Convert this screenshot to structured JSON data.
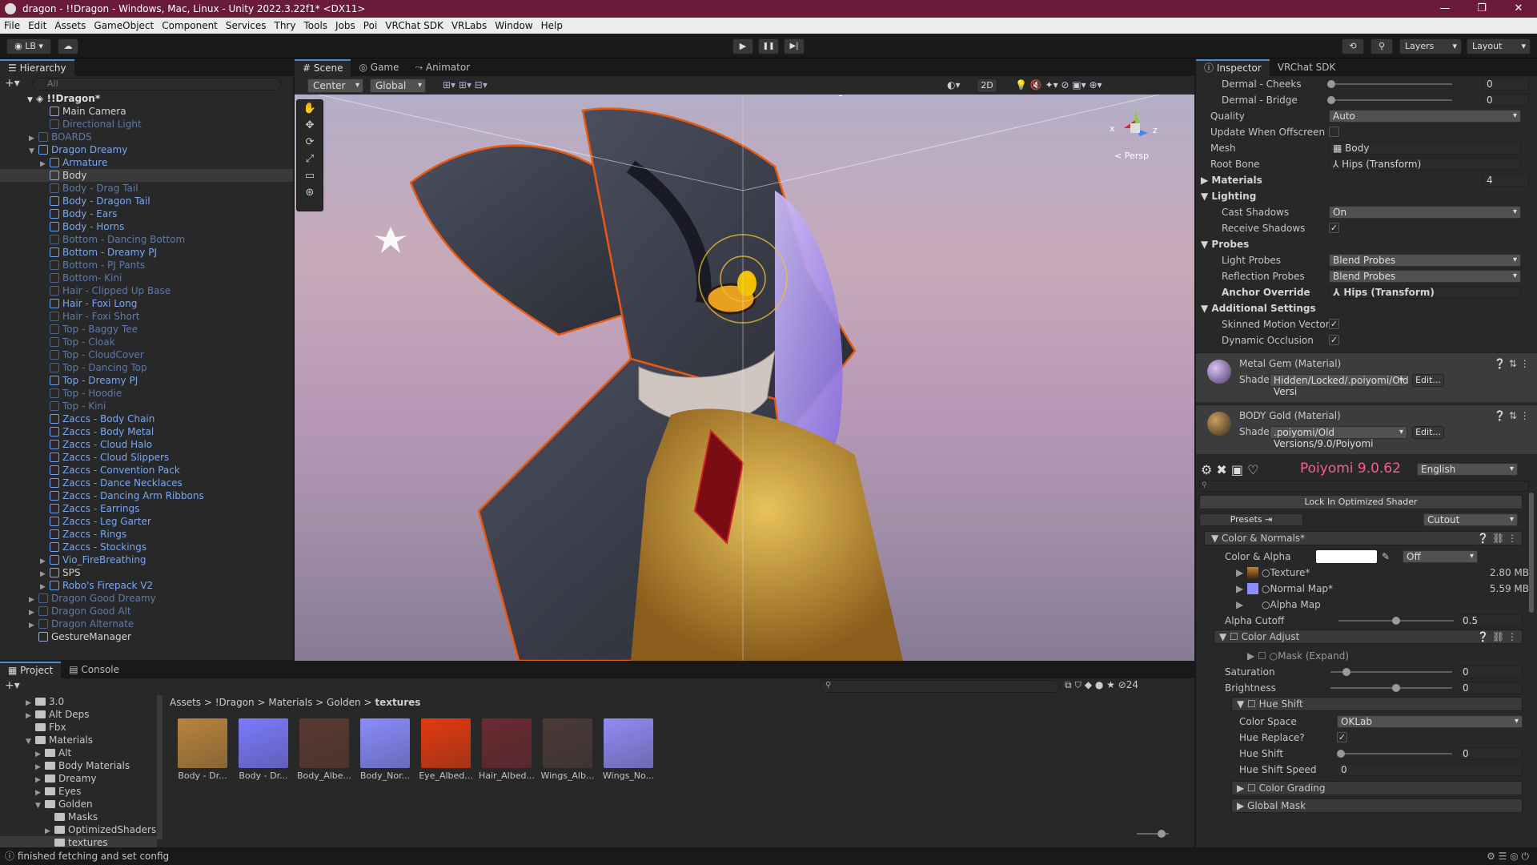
{
  "window": {
    "title": "dragon - !!Dragon - Windows, Mac, Linux - Unity 2022.3.22f1* <DX11>",
    "controls": [
      "—",
      "❐",
      "✕"
    ]
  },
  "menu": [
    "File",
    "Edit",
    "Assets",
    "GameObject",
    "Component",
    "Services",
    "Thry",
    "Tools",
    "Jobs",
    "Poi",
    "VRChat SDK",
    "VRLabs",
    "Window",
    "Help"
  ],
  "toolbar": {
    "account": "LB",
    "play": "▶",
    "pause": "❚❚",
    "step": "▶|",
    "layers": "Layers",
    "layout": "Layout"
  },
  "hierarchy": {
    "tab": "Hierarchy",
    "search_placeholder": "All",
    "root": "!!Dragon*",
    "rows": [
      {
        "label": "Main Camera",
        "style": "white",
        "indent": 1,
        "arrow": ""
      },
      {
        "label": "Directional Light",
        "style": "dim",
        "indent": 1,
        "arrow": ""
      },
      {
        "label": "BOARDS",
        "style": "dim",
        "indent": 0,
        "arrow": "▶"
      },
      {
        "label": "Dragon Dreamy",
        "style": "blue",
        "indent": 0,
        "arrow": "▼"
      },
      {
        "label": "Armature",
        "style": "blue",
        "indent": 1,
        "arrow": "▶"
      },
      {
        "label": "Body",
        "style": "white",
        "indent": 1,
        "arrow": "",
        "selected": true
      },
      {
        "label": "Body - Drag Tail",
        "style": "dim",
        "indent": 1,
        "arrow": ""
      },
      {
        "label": "Body - Dragon Tail",
        "style": "blue",
        "indent": 1,
        "arrow": ""
      },
      {
        "label": "Body - Ears",
        "style": "blue",
        "indent": 1,
        "arrow": ""
      },
      {
        "label": "Body - Horns",
        "style": "blue",
        "indent": 1,
        "arrow": ""
      },
      {
        "label": "Bottom - Dancing Bottom",
        "style": "dim",
        "indent": 1,
        "arrow": ""
      },
      {
        "label": "Bottom - Dreamy PJ",
        "style": "blue",
        "indent": 1,
        "arrow": ""
      },
      {
        "label": "Bottom - PJ Pants",
        "style": "dim",
        "indent": 1,
        "arrow": ""
      },
      {
        "label": "Bottom- Kini",
        "style": "dim",
        "indent": 1,
        "arrow": ""
      },
      {
        "label": "Hair - Clipped Up Base",
        "style": "dim",
        "indent": 1,
        "arrow": ""
      },
      {
        "label": "Hair - Foxi Long",
        "style": "blue",
        "indent": 1,
        "arrow": ""
      },
      {
        "label": "Hair - Foxi Short",
        "style": "dim",
        "indent": 1,
        "arrow": ""
      },
      {
        "label": "Top - Baggy Tee",
        "style": "dim",
        "indent": 1,
        "arrow": ""
      },
      {
        "label": "Top - Cloak",
        "style": "dim",
        "indent": 1,
        "arrow": ""
      },
      {
        "label": "Top - CloudCover",
        "style": "dim",
        "indent": 1,
        "arrow": ""
      },
      {
        "label": "Top - Dancing Top",
        "style": "dim",
        "indent": 1,
        "arrow": ""
      },
      {
        "label": "Top - Dreamy PJ",
        "style": "blue",
        "indent": 1,
        "arrow": ""
      },
      {
        "label": "Top - Hoodie",
        "style": "dim",
        "indent": 1,
        "arrow": ""
      },
      {
        "label": "Top - Kini",
        "style": "dim",
        "indent": 1,
        "arrow": ""
      },
      {
        "label": "Zaccs - Body Chain",
        "style": "blue",
        "indent": 1,
        "arrow": ""
      },
      {
        "label": "Zaccs - Body Metal",
        "style": "blue",
        "indent": 1,
        "arrow": ""
      },
      {
        "label": "Zaccs - Cloud Halo",
        "style": "blue",
        "indent": 1,
        "arrow": ""
      },
      {
        "label": "Zaccs - Cloud Slippers",
        "style": "blue",
        "indent": 1,
        "arrow": ""
      },
      {
        "label": "Zaccs - Convention Pack",
        "style": "blue",
        "indent": 1,
        "arrow": ""
      },
      {
        "label": "Zaccs - Dance Necklaces",
        "style": "blue",
        "indent": 1,
        "arrow": ""
      },
      {
        "label": "Zaccs - Dancing Arm Ribbons",
        "style": "blue",
        "indent": 1,
        "arrow": ""
      },
      {
        "label": "Zaccs - Earrings",
        "style": "blue",
        "indent": 1,
        "arrow": ""
      },
      {
        "label": "Zaccs - Leg Garter",
        "style": "blue",
        "indent": 1,
        "arrow": ""
      },
      {
        "label": "Zaccs - Rings",
        "style": "blue",
        "indent": 1,
        "arrow": ""
      },
      {
        "label": "Zaccs - Stockings",
        "style": "blue",
        "indent": 1,
        "arrow": ""
      },
      {
        "label": "Vio_FireBreathing",
        "style": "blue",
        "indent": 1,
        "arrow": "▶"
      },
      {
        "label": "SPS",
        "style": "white",
        "indent": 1,
        "arrow": "▶"
      },
      {
        "label": "Robo's Firepack V2",
        "style": "blue",
        "indent": 1,
        "arrow": "▶"
      },
      {
        "label": "Dragon Good Dreamy",
        "style": "dim",
        "indent": 0,
        "arrow": "▶"
      },
      {
        "label": "Dragon Good Alt",
        "style": "dim",
        "indent": 0,
        "arrow": "▶"
      },
      {
        "label": "Dragon Alternate",
        "style": "dim",
        "indent": 0,
        "arrow": "▶"
      },
      {
        "label": "GestureManager",
        "style": "white",
        "indent": 0,
        "arrow": ""
      }
    ]
  },
  "scene": {
    "tabs": [
      "Scene",
      "Game",
      "Animator"
    ],
    "pivot": "Center",
    "space": "Global",
    "mode2d": "2D",
    "persp": "< Persp",
    "axis_x": "x",
    "axis_z": "z"
  },
  "inspector": {
    "tabs": [
      "Inspector",
      "VRChat SDK"
    ],
    "rows": {
      "dermal_cheeks": {
        "label": "Dermal - Cheeks",
        "value": "0"
      },
      "dermal_bridge": {
        "label": "Dermal - Bridge",
        "value": "0"
      },
      "quality": {
        "label": "Quality",
        "value": "Auto"
      },
      "update_offscreen": {
        "label": "Update When Offscreen"
      },
      "mesh": {
        "label": "Mesh",
        "value": "Body"
      },
      "root_bone": {
        "label": "Root Bone",
        "value": "Hips (Transform)"
      },
      "materials": {
        "label": "Materials",
        "value": "4"
      },
      "lighting": {
        "label": "Lighting"
      },
      "cast_shadows": {
        "label": "Cast Shadows",
        "value": "On"
      },
      "receive_shadows": {
        "label": "Receive Shadows"
      },
      "probes": {
        "label": "Probes"
      },
      "light_probes": {
        "label": "Light Probes",
        "value": "Blend Probes"
      },
      "reflection_probes": {
        "label": "Reflection Probes",
        "value": "Blend Probes"
      },
      "anchor_override": {
        "label": "Anchor Override",
        "value": "Hips (Transform)"
      },
      "additional": {
        "label": "Additional Settings"
      },
      "skinned_motion": {
        "label": "Skinned Motion Vectors"
      },
      "dynamic_occlusion": {
        "label": "Dynamic Occlusion"
      }
    },
    "material1": {
      "name": "Metal Gem (Material)",
      "shader_label": "Shader",
      "shader": "Hidden/Locked/.poiyomi/Old Versi",
      "edit": "Edit..."
    },
    "material2": {
      "name": "BODY Gold (Material)",
      "shader_label": "Shader",
      "shader": ".poiyomi/Old Versions/9.0/Poiyomi",
      "edit": "Edit..."
    },
    "poiyomi": {
      "title": "Poiyomi 9.0.62",
      "language": "English",
      "lock_button": "Lock In Optimized Shader",
      "presets": "Presets",
      "cutout": "Cutout",
      "color_normals": "Color & Normals*",
      "color_alpha": "Color & Alpha",
      "color_alpha_mode": "Off",
      "texture": "Texture*",
      "texture_size": "2.80 MB",
      "normal_map": "Normal Map*",
      "normal_size": "5.59 MB",
      "alpha_map": "Alpha Map",
      "alpha_cutoff": {
        "label": "Alpha Cutoff",
        "value": "0.5",
        "fraction": 0.5
      },
      "color_adjust": "Color Adjust",
      "mask": "Mask (Expand)",
      "saturation": {
        "label": "Saturation",
        "value": "0",
        "fraction": 0.1
      },
      "brightness": {
        "label": "Brightness",
        "value": "0",
        "fraction": 0.5
      },
      "hue_shift_header": "Hue Shift",
      "color_space": {
        "label": "Color Space",
        "value": "OKLab"
      },
      "hue_replace": "Hue Replace?",
      "hue_shift": {
        "label": "Hue Shift",
        "value": "0",
        "fraction": 0.0
      },
      "hue_shift_speed": {
        "label": "Hue Shift Speed",
        "value": "0"
      },
      "color_grading": "Color Grading",
      "global_mask": "Global Mask"
    }
  },
  "project": {
    "tabs": [
      "Project",
      "Console"
    ],
    "count": "24",
    "breadcrumb": [
      "Assets",
      "!Dragon",
      "Materials",
      "Golden",
      "textures"
    ],
    "tree": [
      {
        "label": "3.0",
        "indent": 1,
        "arrow": "▶"
      },
      {
        "label": "Alt Deps",
        "indent": 1,
        "arrow": "▶"
      },
      {
        "label": "Fbx",
        "indent": 1,
        "arrow": ""
      },
      {
        "label": "Materials",
        "indent": 1,
        "arrow": "▼"
      },
      {
        "label": "Alt",
        "indent": 2,
        "arrow": "▶"
      },
      {
        "label": "Body Materials",
        "indent": 2,
        "arrow": "▶"
      },
      {
        "label": "Dreamy",
        "indent": 2,
        "arrow": "▶"
      },
      {
        "label": "Eyes",
        "indent": 2,
        "arrow": "▶"
      },
      {
        "label": "Golden",
        "indent": 2,
        "arrow": "▼"
      },
      {
        "label": "Masks",
        "indent": 3,
        "arrow": ""
      },
      {
        "label": "OptimizedShaders",
        "indent": 3,
        "arrow": "▶"
      },
      {
        "label": "textures",
        "indent": 3,
        "arrow": "",
        "selected": true
      }
    ],
    "assets": [
      {
        "label": "Body - Dr...",
        "color": "#b8843c"
      },
      {
        "label": "Body - Dr...",
        "color": "#7b7bff"
      },
      {
        "label": "Body_Albe...",
        "color": "#5a3a30"
      },
      {
        "label": "Body_Nor...",
        "color": "#8a8cff"
      },
      {
        "label": "Eye_Albed...",
        "color": "#e23a10"
      },
      {
        "label": "Hair_Albed...",
        "color": "#6a2a30"
      },
      {
        "label": "Wings_Alb...",
        "color": "#4a3a38"
      },
      {
        "label": "Wings_No...",
        "color": "#8f8cf5"
      }
    ]
  },
  "status": "finished fetching and set config"
}
